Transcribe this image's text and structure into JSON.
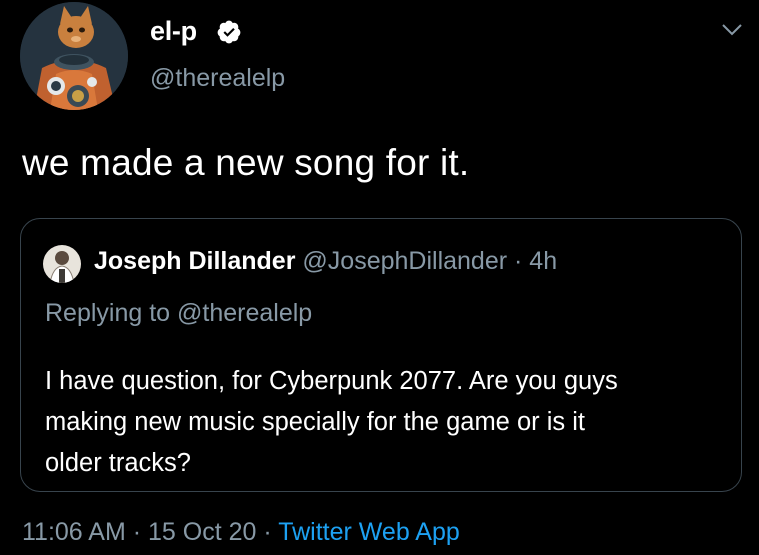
{
  "tweet": {
    "author": {
      "display_name": "el-p",
      "handle": "@therealelp",
      "verified": true,
      "avatar_icon": "cat-astronaut-avatar"
    },
    "text": "we made a new song for it.",
    "timestamp": {
      "time": "11:06 AM",
      "separator": "·",
      "date": "15 Oct 20",
      "source": "Twitter Web App"
    }
  },
  "quoted_tweet": {
    "author": {
      "display_name": "Joseph Dillander",
      "handle": "@JosephDillander",
      "separator": "·",
      "age": "4h"
    },
    "replying_to": "Replying to @therealelp",
    "text_lines": [
      "I have question, for Cyberpunk 2077. Are you guys",
      "making new music specially for the game or is it",
      "older tracks?"
    ]
  },
  "colors": {
    "background": "#000000",
    "primary_text": "#ffffff",
    "secondary_text": "#8899a6",
    "accent": "#1da1f2",
    "border": "#38444d"
  }
}
